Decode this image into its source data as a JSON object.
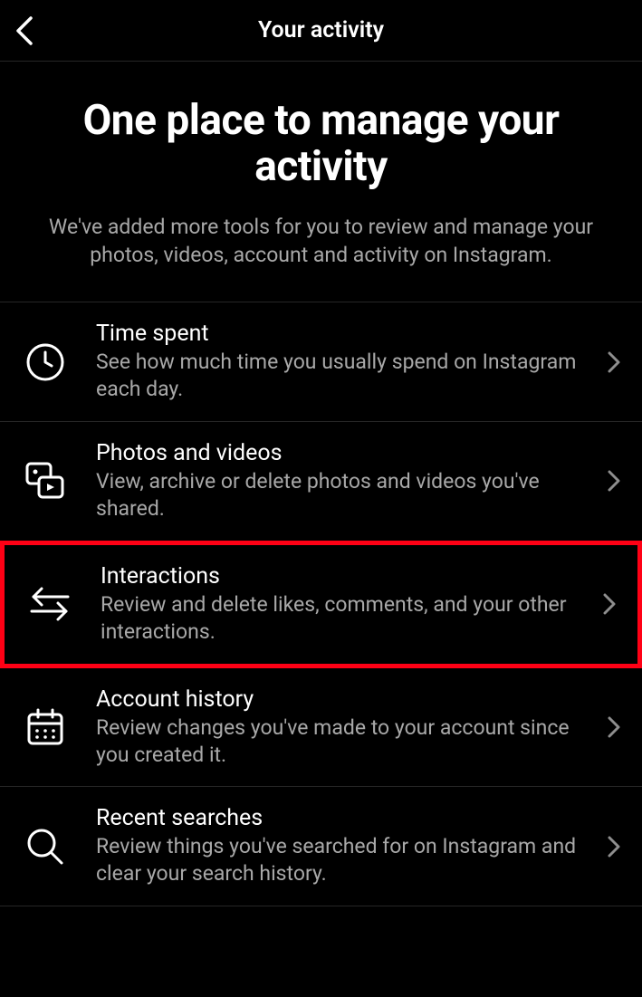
{
  "header": {
    "title": "Your activity"
  },
  "hero": {
    "title": "One place to manage your activity",
    "subtitle": "We've added more tools for you to review and manage your photos, videos, account and activity on Instagram."
  },
  "items": [
    {
      "title": "Time spent",
      "desc": "See how much time you usually spend on Instagram each day."
    },
    {
      "title": "Photos and videos",
      "desc": "View, archive or delete photos and videos you've shared."
    },
    {
      "title": "Interactions",
      "desc": "Review and delete likes, comments, and your other interactions."
    },
    {
      "title": "Account history",
      "desc": "Review changes you've made to your account since you created it."
    },
    {
      "title": "Recent searches",
      "desc": "Review things you've searched for on Instagram and clear your search history."
    }
  ]
}
